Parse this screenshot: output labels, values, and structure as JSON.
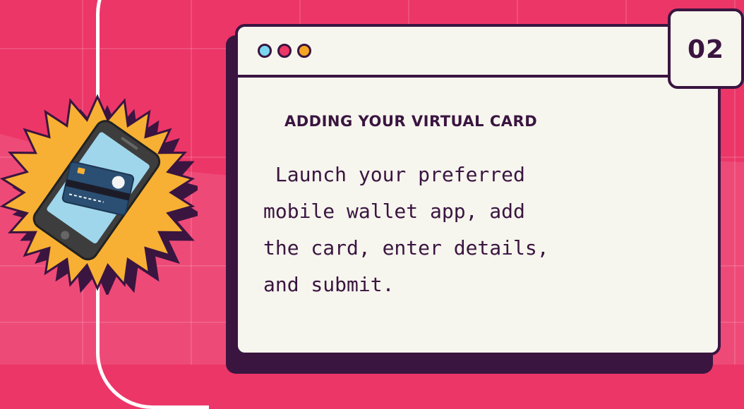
{
  "card": {
    "step_number": "02",
    "title": "ADDING YOUR VIRTUAL CARD",
    "body": " Launch your preferred\nmobile wallet app, add\nthe card, enter details,\nand submit.",
    "window_dots": [
      "#7ad7f0",
      "#ec3668",
      "#f5a623"
    ]
  },
  "illustration": {
    "icon": "phone-with-credit-card-icon",
    "badge": "starburst-badge"
  },
  "colors": {
    "background": "#ec3668",
    "accent_dark": "#3a1540",
    "card_bg": "#f6f5ee",
    "burst": "#f7b033"
  }
}
